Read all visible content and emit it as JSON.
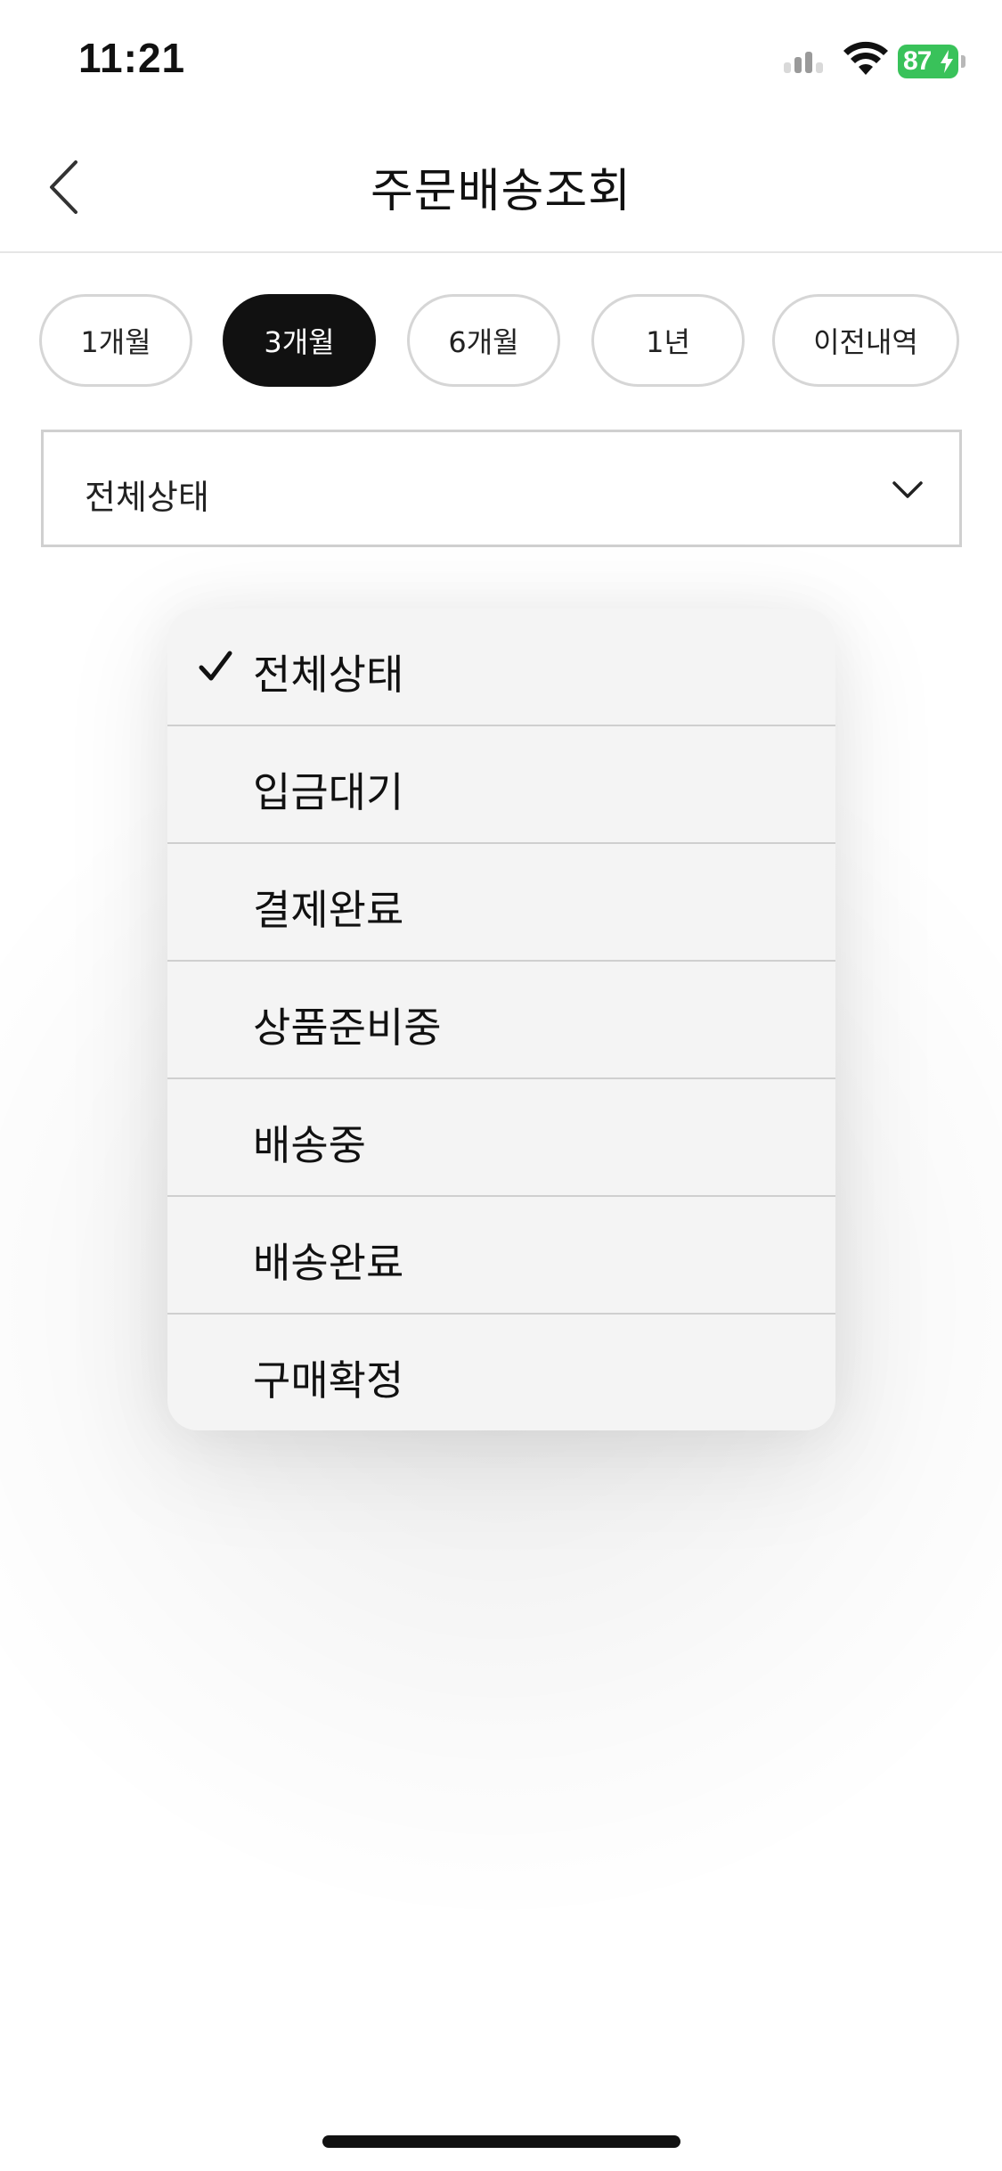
{
  "status_bar": {
    "time": "11:21",
    "battery_level": "87",
    "icons": [
      "signal-icon",
      "wifi-icon",
      "battery-charging-icon"
    ]
  },
  "header": {
    "title": "주문배송조회",
    "back_icon": "chevron-left-icon"
  },
  "period_filter": {
    "options": [
      "1개월",
      "3개월",
      "6개월",
      "1년",
      "이전내역"
    ],
    "selected": "3개월"
  },
  "status_select": {
    "value": "전체상태",
    "icon": "chevron-down-icon"
  },
  "status_menu": {
    "items": [
      "전체상태",
      "입금대기",
      "결제완료",
      "상품준비중",
      "배송중",
      "배송완료",
      "구매확정"
    ],
    "selected": "전체상태",
    "check_icon": "checkmark-icon"
  },
  "colors": {
    "active_chip": "#111111",
    "battery": "#39c25a",
    "menu_background": "#f4f4f4"
  }
}
